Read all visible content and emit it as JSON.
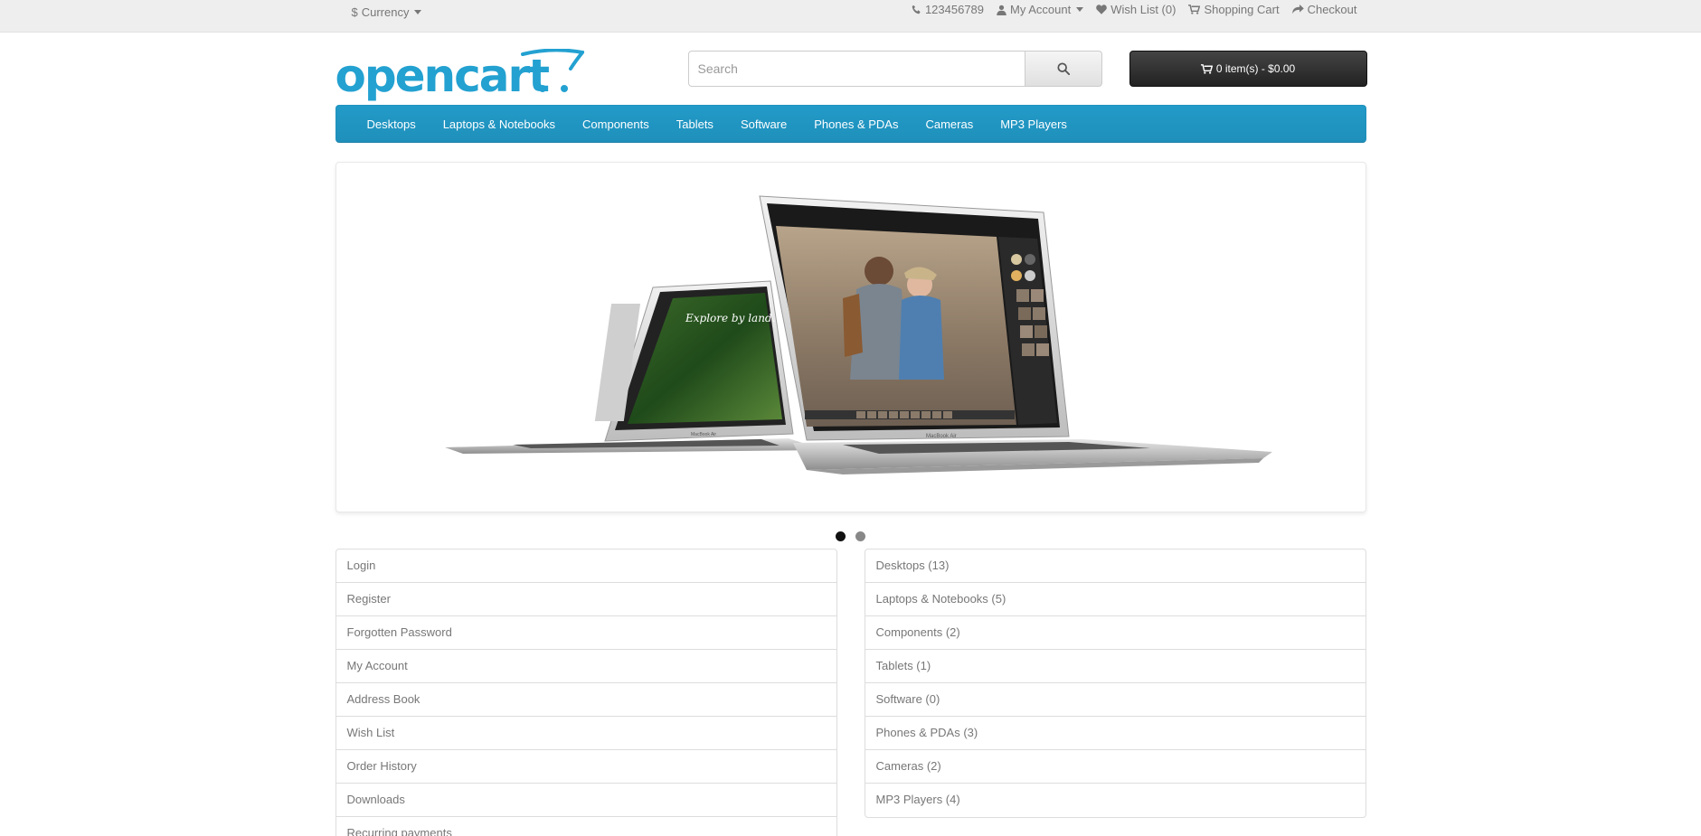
{
  "topbar": {
    "currency_label": "Currency",
    "currency_symbol": "$",
    "phone": "123456789",
    "my_account": "My Account",
    "wish_list": "Wish List (0)",
    "shopping_cart": "Shopping Cart",
    "checkout": "Checkout"
  },
  "header": {
    "logo_text": "opencart",
    "search_placeholder": "Search",
    "cart_summary": "0 item(s) - $0.00"
  },
  "menu": {
    "items": [
      "Desktops",
      "Laptops & Notebooks",
      "Components",
      "Tablets",
      "Software",
      "Phones & PDAs",
      "Cameras",
      "MP3 Players"
    ]
  },
  "slideshow": {
    "left_screen_caption": "Explore by land.",
    "laptop_label": "MacBook Air",
    "slide_count": 2,
    "active_slide": 1
  },
  "account_links": [
    "Login",
    "Register",
    "Forgotten Password",
    "My Account",
    "Address Book",
    "Wish List",
    "Order History",
    "Downloads",
    "Recurring payments"
  ],
  "category_links": [
    "Desktops (13)",
    "Laptops & Notebooks (5)",
    "Components (2)",
    "Tablets (1)",
    "Software (0)",
    "Phones & PDAs (3)",
    "Cameras (2)",
    "MP3 Players (4)"
  ],
  "colors": {
    "brand_blue": "#229ac8",
    "cart_button": "#333333",
    "topbar_bg": "#eeeeee"
  }
}
